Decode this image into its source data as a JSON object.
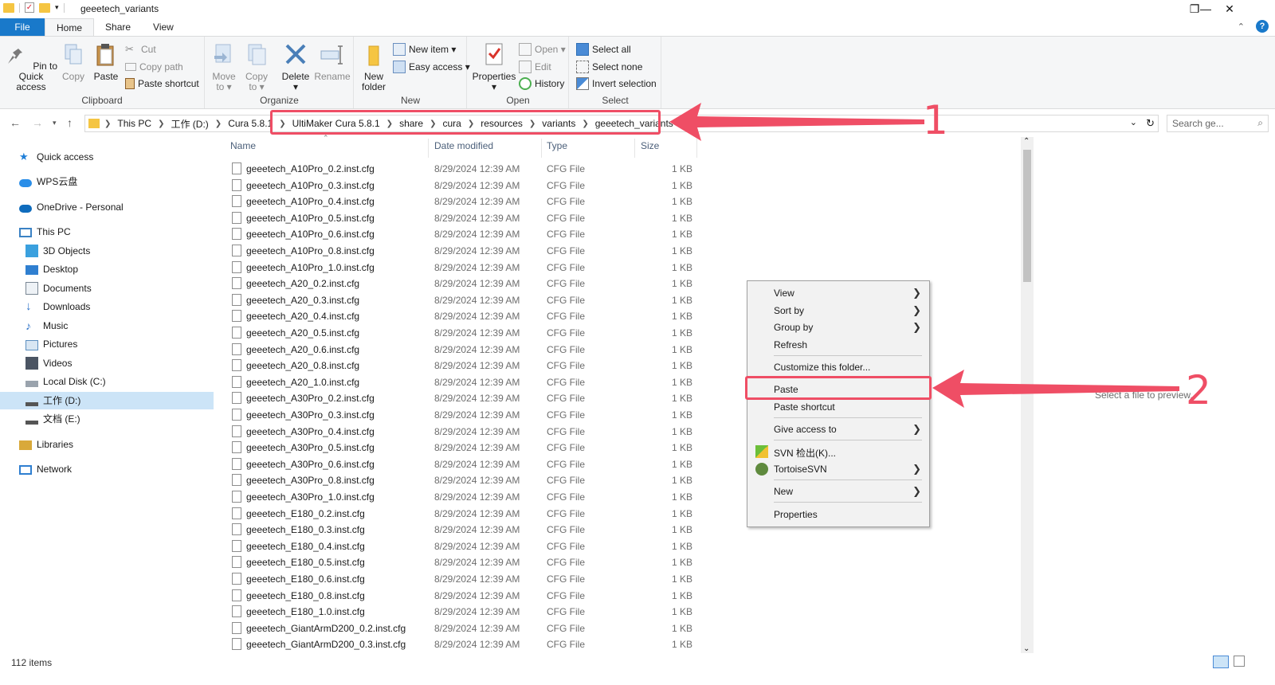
{
  "window": {
    "title": "geeetech_variants",
    "controls": [
      "minimize",
      "maximize",
      "close"
    ]
  },
  "tabs": [
    {
      "label": "File",
      "name": "tab-file"
    },
    {
      "label": "Home",
      "name": "tab-home"
    },
    {
      "label": "Share",
      "name": "tab-share"
    },
    {
      "label": "View",
      "name": "tab-view"
    }
  ],
  "ribbon": {
    "clipboard": {
      "label": "Clipboard",
      "pin": "Pin to Quick\naccess",
      "copy": "Copy",
      "paste": "Paste",
      "cut": "Cut",
      "copy_path": "Copy path",
      "paste_shortcut": "Paste shortcut"
    },
    "organize": {
      "label": "Organize",
      "move_to": "Move\nto ▾",
      "copy_to": "Copy\nto ▾",
      "delete": "Delete\n▾",
      "rename": "Rename"
    },
    "new": {
      "label": "New",
      "new_folder": "New\nfolder",
      "new_item": "New item ▾",
      "easy_access": "Easy access ▾"
    },
    "open": {
      "label": "Open",
      "properties": "Properties\n▾",
      "open": "Open ▾",
      "edit": "Edit",
      "history": "History"
    },
    "select": {
      "label": "Select",
      "select_all": "Select all",
      "select_none": "Select none",
      "invert": "Invert selection"
    }
  },
  "address": {
    "crumbs": [
      "This PC",
      "工作 (D:)",
      "Cura 5.8.1",
      "UltiMaker Cura 5.8.1",
      "share",
      "cura",
      "resources",
      "variants",
      "geeetech_variants"
    ],
    "search_placeholder": "Search ge..."
  },
  "sidebar": [
    {
      "label": "Quick access",
      "icon": "star-icon",
      "color": "#1f7fd8"
    },
    {
      "label": "WPS云盘",
      "icon": "cloud-icon",
      "color": "#2a8ee8"
    },
    {
      "label": "OneDrive - Personal",
      "icon": "onedrive-icon",
      "color": "#0f6cbd"
    },
    {
      "label": "This PC",
      "icon": "computer-icon",
      "color": "#3b82c4"
    },
    {
      "label": "3D Objects",
      "icon": "cube-icon",
      "color": "#3aa0de"
    },
    {
      "label": "Desktop",
      "icon": "desktop-icon",
      "color": "#2f7fd0"
    },
    {
      "label": "Documents",
      "icon": "documents-icon",
      "color": "#7a8794"
    },
    {
      "label": "Downloads",
      "icon": "download-icon",
      "color": "#2c72c8"
    },
    {
      "label": "Music",
      "icon": "music-icon",
      "color": "#2c72c8"
    },
    {
      "label": "Pictures",
      "icon": "pictures-icon",
      "color": "#5c8fc0"
    },
    {
      "label": "Videos",
      "icon": "videos-icon",
      "color": "#4b5563"
    },
    {
      "label": "Local Disk (C:)",
      "icon": "disk-icon",
      "color": "#6b7280"
    },
    {
      "label": "工作 (D:)",
      "icon": "drive-icon",
      "color": "#555555"
    },
    {
      "label": "文档 (E:)",
      "icon": "drive-icon",
      "color": "#555555"
    },
    {
      "label": "Libraries",
      "icon": "libraries-icon",
      "color": "#d9a93a"
    },
    {
      "label": "Network",
      "icon": "network-icon",
      "color": "#2f7fd0"
    }
  ],
  "columns": {
    "name": "Name",
    "date": "Date modified",
    "type": "Type",
    "size": "Size"
  },
  "files": [
    {
      "name": "geeetech_A10Pro_0.2.inst.cfg",
      "date": "8/29/2024 12:39 AM",
      "type": "CFG File",
      "size": "1 KB"
    },
    {
      "name": "geeetech_A10Pro_0.3.inst.cfg",
      "date": "8/29/2024 12:39 AM",
      "type": "CFG File",
      "size": "1 KB"
    },
    {
      "name": "geeetech_A10Pro_0.4.inst.cfg",
      "date": "8/29/2024 12:39 AM",
      "type": "CFG File",
      "size": "1 KB"
    },
    {
      "name": "geeetech_A10Pro_0.5.inst.cfg",
      "date": "8/29/2024 12:39 AM",
      "type": "CFG File",
      "size": "1 KB"
    },
    {
      "name": "geeetech_A10Pro_0.6.inst.cfg",
      "date": "8/29/2024 12:39 AM",
      "type": "CFG File",
      "size": "1 KB"
    },
    {
      "name": "geeetech_A10Pro_0.8.inst.cfg",
      "date": "8/29/2024 12:39 AM",
      "type": "CFG File",
      "size": "1 KB"
    },
    {
      "name": "geeetech_A10Pro_1.0.inst.cfg",
      "date": "8/29/2024 12:39 AM",
      "type": "CFG File",
      "size": "1 KB"
    },
    {
      "name": "geeetech_A20_0.2.inst.cfg",
      "date": "8/29/2024 12:39 AM",
      "type": "CFG File",
      "size": "1 KB"
    },
    {
      "name": "geeetech_A20_0.3.inst.cfg",
      "date": "8/29/2024 12:39 AM",
      "type": "CFG File",
      "size": "1 KB"
    },
    {
      "name": "geeetech_A20_0.4.inst.cfg",
      "date": "8/29/2024 12:39 AM",
      "type": "CFG File",
      "size": "1 KB"
    },
    {
      "name": "geeetech_A20_0.5.inst.cfg",
      "date": "8/29/2024 12:39 AM",
      "type": "CFG File",
      "size": "1 KB"
    },
    {
      "name": "geeetech_A20_0.6.inst.cfg",
      "date": "8/29/2024 12:39 AM",
      "type": "CFG File",
      "size": "1 KB"
    },
    {
      "name": "geeetech_A20_0.8.inst.cfg",
      "date": "8/29/2024 12:39 AM",
      "type": "CFG File",
      "size": "1 KB"
    },
    {
      "name": "geeetech_A20_1.0.inst.cfg",
      "date": "8/29/2024 12:39 AM",
      "type": "CFG File",
      "size": "1 KB"
    },
    {
      "name": "geeetech_A30Pro_0.2.inst.cfg",
      "date": "8/29/2024 12:39 AM",
      "type": "CFG File",
      "size": "1 KB"
    },
    {
      "name": "geeetech_A30Pro_0.3.inst.cfg",
      "date": "8/29/2024 12:39 AM",
      "type": "CFG File",
      "size": "1 KB"
    },
    {
      "name": "geeetech_A30Pro_0.4.inst.cfg",
      "date": "8/29/2024 12:39 AM",
      "type": "CFG File",
      "size": "1 KB"
    },
    {
      "name": "geeetech_A30Pro_0.5.inst.cfg",
      "date": "8/29/2024 12:39 AM",
      "type": "CFG File",
      "size": "1 KB"
    },
    {
      "name": "geeetech_A30Pro_0.6.inst.cfg",
      "date": "8/29/2024 12:39 AM",
      "type": "CFG File",
      "size": "1 KB"
    },
    {
      "name": "geeetech_A30Pro_0.8.inst.cfg",
      "date": "8/29/2024 12:39 AM",
      "type": "CFG File",
      "size": "1 KB"
    },
    {
      "name": "geeetech_A30Pro_1.0.inst.cfg",
      "date": "8/29/2024 12:39 AM",
      "type": "CFG File",
      "size": "1 KB"
    },
    {
      "name": "geeetech_E180_0.2.inst.cfg",
      "date": "8/29/2024 12:39 AM",
      "type": "CFG File",
      "size": "1 KB"
    },
    {
      "name": "geeetech_E180_0.3.inst.cfg",
      "date": "8/29/2024 12:39 AM",
      "type": "CFG File",
      "size": "1 KB"
    },
    {
      "name": "geeetech_E180_0.4.inst.cfg",
      "date": "8/29/2024 12:39 AM",
      "type": "CFG File",
      "size": "1 KB"
    },
    {
      "name": "geeetech_E180_0.5.inst.cfg",
      "date": "8/29/2024 12:39 AM",
      "type": "CFG File",
      "size": "1 KB"
    },
    {
      "name": "geeetech_E180_0.6.inst.cfg",
      "date": "8/29/2024 12:39 AM",
      "type": "CFG File",
      "size": "1 KB"
    },
    {
      "name": "geeetech_E180_0.8.inst.cfg",
      "date": "8/29/2024 12:39 AM",
      "type": "CFG File",
      "size": "1 KB"
    },
    {
      "name": "geeetech_E180_1.0.inst.cfg",
      "date": "8/29/2024 12:39 AM",
      "type": "CFG File",
      "size": "1 KB"
    },
    {
      "name": "geeetech_GiantArmD200_0.2.inst.cfg",
      "date": "8/29/2024 12:39 AM",
      "type": "CFG File",
      "size": "1 KB"
    },
    {
      "name": "geeetech_GiantArmD200_0.3.inst.cfg",
      "date": "8/29/2024 12:39 AM",
      "type": "CFG File",
      "size": "1 KB"
    }
  ],
  "status": {
    "item_count": "112 items"
  },
  "preview_text": "Select a file to preview.",
  "context_menu": [
    {
      "label": "View",
      "sub": true
    },
    {
      "label": "Sort by",
      "sub": true
    },
    {
      "label": "Group by",
      "sub": true
    },
    {
      "label": "Refresh",
      "sub": false
    },
    {
      "label": "Customize this folder...",
      "sub": false
    },
    {
      "label": "Paste",
      "sub": false
    },
    {
      "label": "Paste shortcut",
      "sub": false
    },
    {
      "label": "Give access to",
      "sub": true
    },
    {
      "label": "SVN 检出(K)...",
      "sub": false,
      "icon": "svn-checkout-icon"
    },
    {
      "label": "TortoiseSVN",
      "sub": true,
      "icon": "tortoise-icon"
    },
    {
      "label": "New",
      "sub": true
    },
    {
      "label": "Properties",
      "sub": false
    }
  ],
  "annotations": {
    "one": "1",
    "two": "2",
    "color": "#ef4e65"
  },
  "colors": {
    "accent": "#1979ca",
    "selection": "#cce4f7",
    "annotation": "#ef4e65"
  }
}
